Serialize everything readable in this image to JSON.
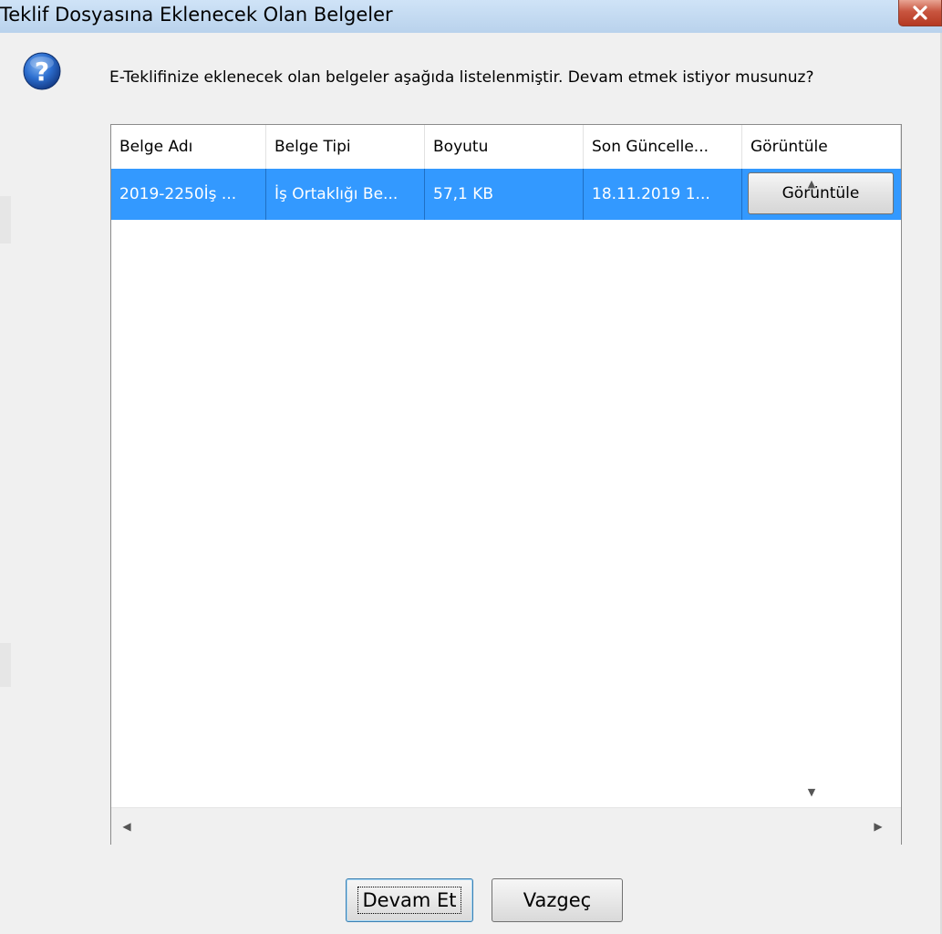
{
  "window": {
    "title": "Teklif Dosyasına Eklenecek Olan Belgeler",
    "close_icon": "close-icon"
  },
  "dialog": {
    "icon": "question-icon",
    "message": "E-Teklifinize eklenecek olan belgeler aşağıda listelenmiştir. Devam etmek istiyor musunuz?"
  },
  "table": {
    "columns": [
      "Belge Adı",
      "Belge Tipi",
      "Boyutu",
      "Son Güncelle...",
      "Görüntüle"
    ],
    "rows": [
      {
        "name": "2019-2250İş ...",
        "type": "İş Ortaklığı Be...",
        "size": "57,1 KB",
        "updated": "18.11.2019 1...",
        "view_label": "Görüntüle"
      }
    ],
    "selected_color": "#3399ff"
  },
  "buttons": {
    "continue_label": "Devam Et",
    "cancel_label": "Vazgeç"
  }
}
